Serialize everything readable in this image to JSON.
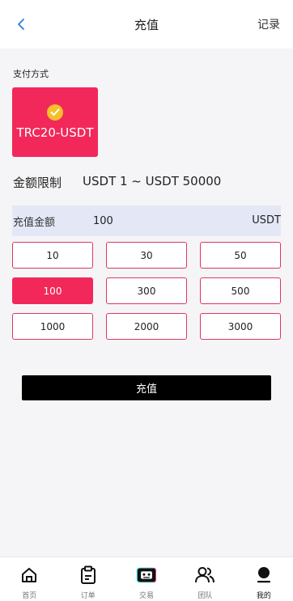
{
  "header": {
    "title": "充值",
    "record_label": "记录"
  },
  "payment": {
    "section_label": "支付方式",
    "method_name": "TRC20-USDT"
  },
  "limit": {
    "label": "金额限制",
    "range": "USDT 1 ~ USDT 50000"
  },
  "amount": {
    "label": "充值金额",
    "value": "100",
    "unit": "USDT"
  },
  "amount_options": [
    {
      "label": "10",
      "selected": false
    },
    {
      "label": "30",
      "selected": false
    },
    {
      "label": "50",
      "selected": false
    },
    {
      "label": "100",
      "selected": true
    },
    {
      "label": "300",
      "selected": false
    },
    {
      "label": "500",
      "selected": false
    },
    {
      "label": "1000",
      "selected": false
    },
    {
      "label": "2000",
      "selected": false
    },
    {
      "label": "3000",
      "selected": false
    }
  ],
  "submit_label": "充值",
  "tabbar": {
    "items": [
      {
        "label": "首页",
        "icon": "home-icon"
      },
      {
        "label": "订单",
        "icon": "clipboard-icon"
      },
      {
        "label": "交易",
        "icon": "robot-icon"
      },
      {
        "label": "团队",
        "icon": "users-icon"
      },
      {
        "label": "我的",
        "icon": "user-icon",
        "active": true
      }
    ]
  },
  "colors": {
    "accent": "#f2285a",
    "check": "#f5c02a",
    "amount_bg": "#e4e8f6",
    "back_arrow": "#2a7fd4"
  }
}
